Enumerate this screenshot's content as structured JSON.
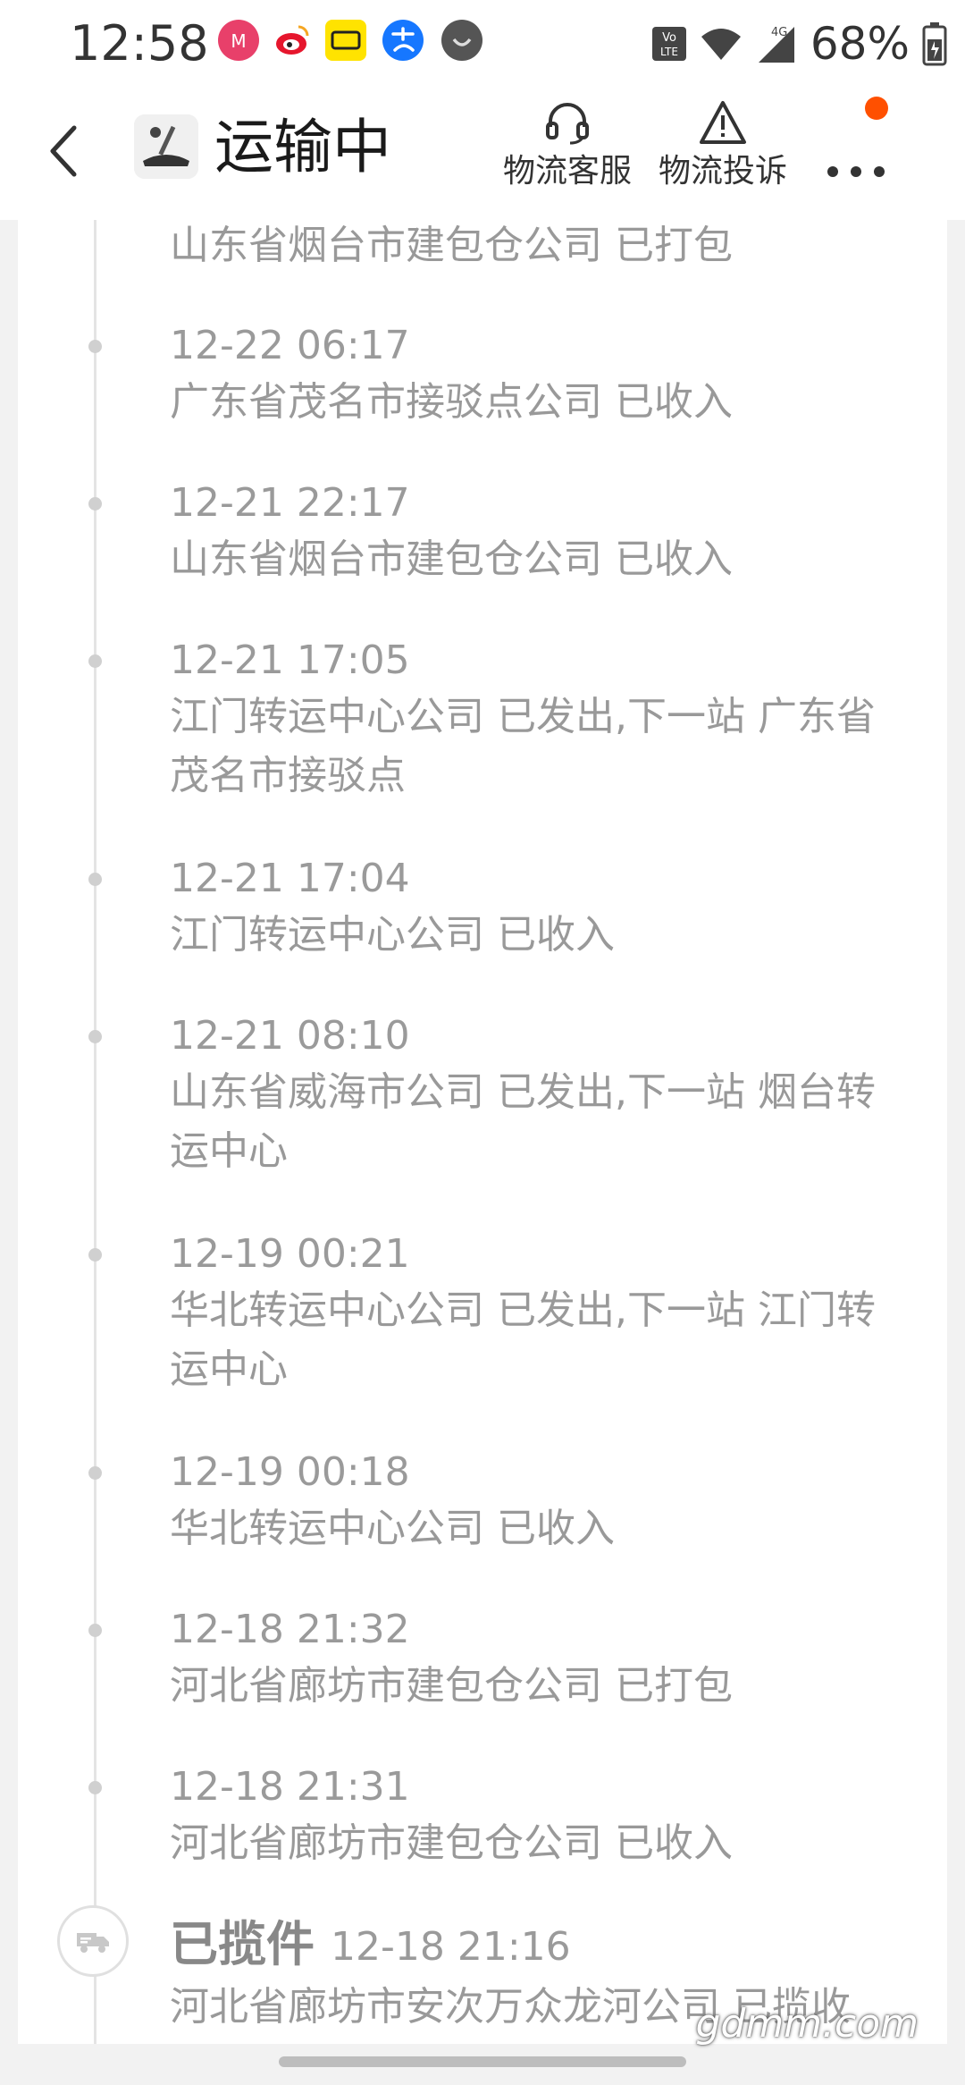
{
  "status_bar": {
    "time": "12:58",
    "battery": "68%",
    "network": "4G",
    "volte": "Vo LTE",
    "app_icons": [
      "meitu-icon",
      "weibo-icon",
      "xianyu-icon",
      "alipay-icon",
      "app-icon-grey"
    ]
  },
  "header": {
    "title": "运输中",
    "service_label": "物流客服",
    "complaint_label": "物流投诉"
  },
  "colors": {
    "accent": "#ff5000",
    "text_secondary": "#999999",
    "timeline": "#e4e4e4"
  },
  "timeline": {
    "first_desc": "山东省烟台市建包仓公司 已打包",
    "entries": [
      {
        "time": "12-22 06:17",
        "desc": "广东省茂名市接驳点公司 已收入"
      },
      {
        "time": "12-21 22:17",
        "desc": "山东省烟台市建包仓公司 已收入"
      },
      {
        "time": "12-21 17:05",
        "desc": "江门转运中心公司 已发出,下一站 广东省茂名市接驳点"
      },
      {
        "time": "12-21 17:04",
        "desc": "江门转运中心公司 已收入"
      },
      {
        "time": "12-21 08:10",
        "desc": "山东省威海市公司 已发出,下一站 烟台转运中心"
      },
      {
        "time": "12-19 00:21",
        "desc": "华北转运中心公司 已发出,下一站 江门转运中心"
      },
      {
        "time": "12-19 00:18",
        "desc": "华北转运中心公司 已收入"
      },
      {
        "time": "12-18 21:32",
        "desc": "河北省廊坊市建包仓公司 已打包"
      },
      {
        "time": "12-18 21:31",
        "desc": "河北省廊坊市建包仓公司 已收入"
      }
    ],
    "pickup": {
      "title": "已揽件",
      "time": "12-18 21:16",
      "desc": "河北省廊坊市安次万众龙河公司 已揽收"
    }
  },
  "watermark": "gdmm.com"
}
